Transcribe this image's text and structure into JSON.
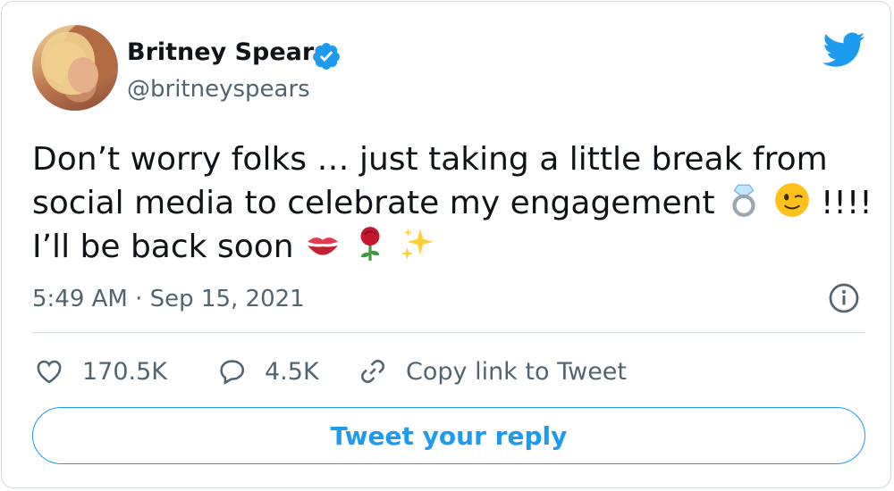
{
  "author": {
    "name": "Britney Spears",
    "handle": "@britneyspears",
    "verified": true
  },
  "tweet": {
    "text_line1": "Don’t worry folks … just taking a little break from",
    "text_line2_before": "social media to celebrate my engagement",
    "text_line2_after": "!!!!",
    "text_line3": "I’ll be back soon",
    "emojis": [
      "ring-emoji",
      "winking-face-emoji",
      "kiss-mark-emoji",
      "rose-emoji",
      "sparkles-emoji"
    ],
    "timestamp": "5:49 AM · Sep 15, 2021"
  },
  "actions": {
    "like_count": "170.5K",
    "reply_count": "4.5K",
    "copy_link_label": "Copy link to Tweet"
  },
  "reply_button_label": "Tweet your reply",
  "colors": {
    "accent": "#1d9bf0",
    "muted_text": "#536471",
    "border": "#cfd9de"
  }
}
